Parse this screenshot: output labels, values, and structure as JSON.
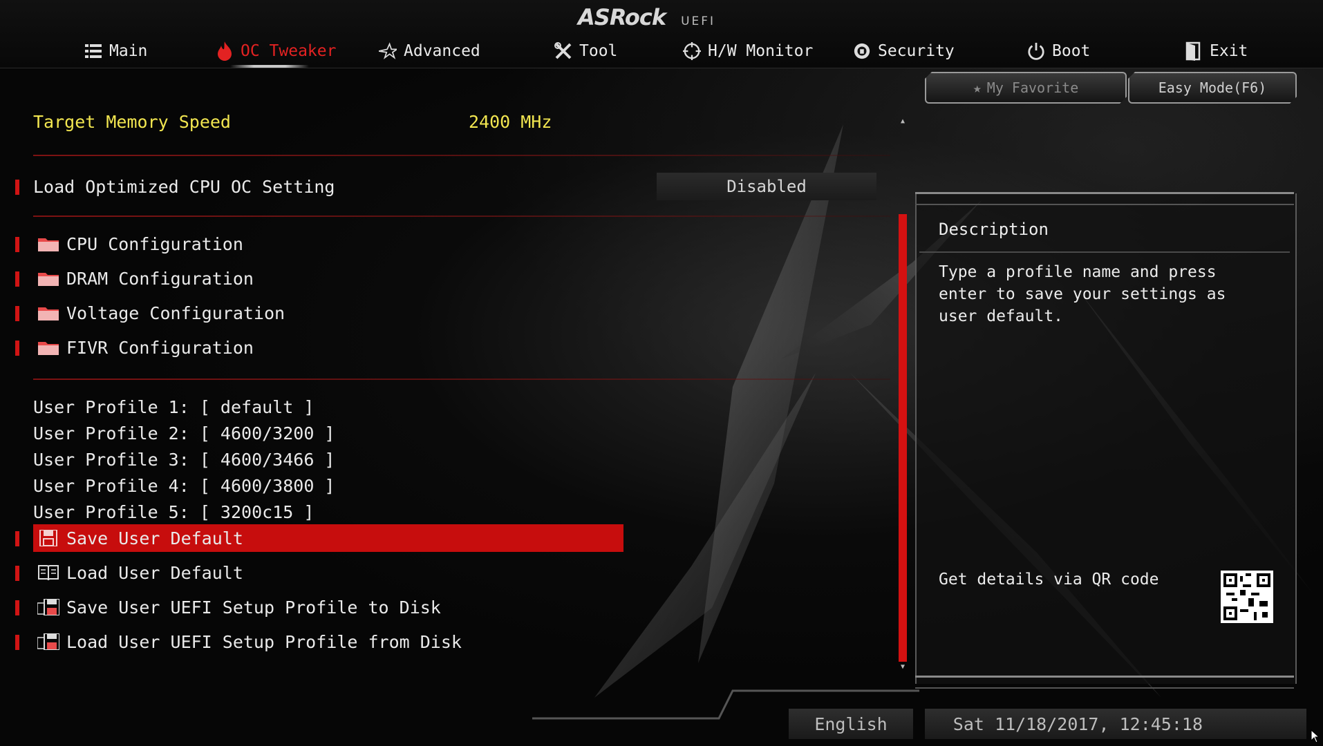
{
  "brand": {
    "logo": "ASRock",
    "sub": "UEFI"
  },
  "tabs": [
    {
      "label": "Main",
      "icon": "list-icon"
    },
    {
      "label": "OC Tweaker",
      "icon": "flame-icon",
      "active": true
    },
    {
      "label": "Advanced",
      "icon": "star-icon"
    },
    {
      "label": "Tool",
      "icon": "tools-icon"
    },
    {
      "label": "H/W Monitor",
      "icon": "crosshair-icon"
    },
    {
      "label": "Security",
      "icon": "shield-icon"
    },
    {
      "label": "Boot",
      "icon": "power-icon"
    },
    {
      "label": "Exit",
      "icon": "exit-door-icon"
    }
  ],
  "buttons": {
    "favorite": "My Favorite",
    "easy_mode": "Easy Mode(F6)"
  },
  "settings": {
    "target_memory_label": "Target Memory Speed",
    "target_memory_value": "2400 MHz",
    "load_cpu_oc_label": "Load Optimized CPU OC Setting",
    "load_cpu_oc_value": "Disabled"
  },
  "submenus": [
    "CPU Configuration",
    "DRAM Configuration",
    "Voltage Configuration",
    "FIVR Configuration"
  ],
  "profiles": [
    "User Profile 1: [ default ]",
    "User Profile 2: [ 4600/3200 ]",
    "User Profile 3: [ 4600/3466 ]",
    "User Profile 4: [ 4600/3800 ]",
    "User Profile 5: [ 3200c15 ]"
  ],
  "actions": [
    {
      "label": "Save User Default",
      "icon": "floppy-icon",
      "selected": true
    },
    {
      "label": "Load User Default",
      "icon": "book-icon"
    },
    {
      "label": "Save User UEFI Setup Profile to Disk",
      "icon": "disk-save-icon"
    },
    {
      "label": "Load User UEFI Setup Profile from Disk",
      "icon": "disk-load-icon"
    }
  ],
  "description": {
    "title": "Description",
    "text": "Type a profile name and press enter to save your settings as user default.",
    "qr_label": "Get details via QR code"
  },
  "status": {
    "language": "English",
    "datetime": "Sat 11/18/2017, 12:45:18"
  },
  "colors": {
    "accent": "#d01414",
    "highlight": "#c70d0d",
    "title_yellow": "#f2e650"
  }
}
